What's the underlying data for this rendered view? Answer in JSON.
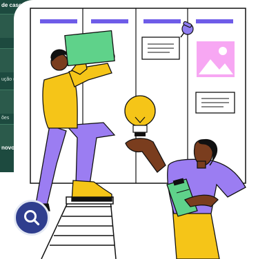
{
  "background_app": {
    "lines": [
      "de caso",
      "ução (...",
      "ões",
      "novos p"
    ]
  },
  "search": {
    "icon": "search-icon"
  },
  "illustration": {
    "board_color": "#ffffff",
    "accent": "#6e5ce8",
    "yellow": "#f5c518"
  }
}
